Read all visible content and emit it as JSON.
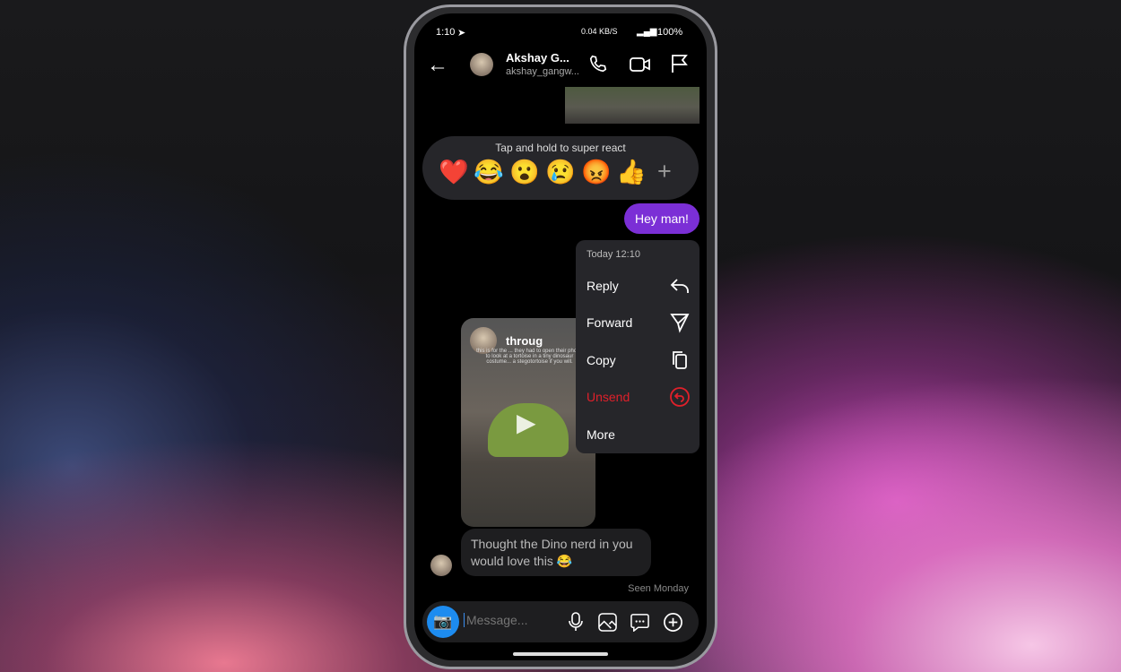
{
  "status": {
    "time": "1:10",
    "network": "0.04 KB/S",
    "battery": "100%"
  },
  "header": {
    "name": "Akshay G...",
    "username": "akshay_gangw..."
  },
  "reactions": {
    "hint": "Tap and hold to super react",
    "emojis": [
      "❤️",
      "😂",
      "😮",
      "😢",
      "😡",
      "👍"
    ],
    "more": "+"
  },
  "messages": {
    "sent": "Hey man!",
    "video_overlay_title": "throug",
    "video_overlay_text": "this is for the ... they had to open their phone to look at a tortoise in a tiny dinosaur costume... a stegotortoise if you will.",
    "caption": "Thought the Dino nerd in you would love this 😂",
    "seen": "Seen Monday"
  },
  "menu": {
    "timestamp": "Today 12:10",
    "items": [
      {
        "label": "Reply"
      },
      {
        "label": "Forward"
      },
      {
        "label": "Copy"
      },
      {
        "label": "Unsend",
        "color": "#e0202a"
      },
      {
        "label": "More"
      }
    ]
  },
  "composer": {
    "placeholder": "Message..."
  }
}
